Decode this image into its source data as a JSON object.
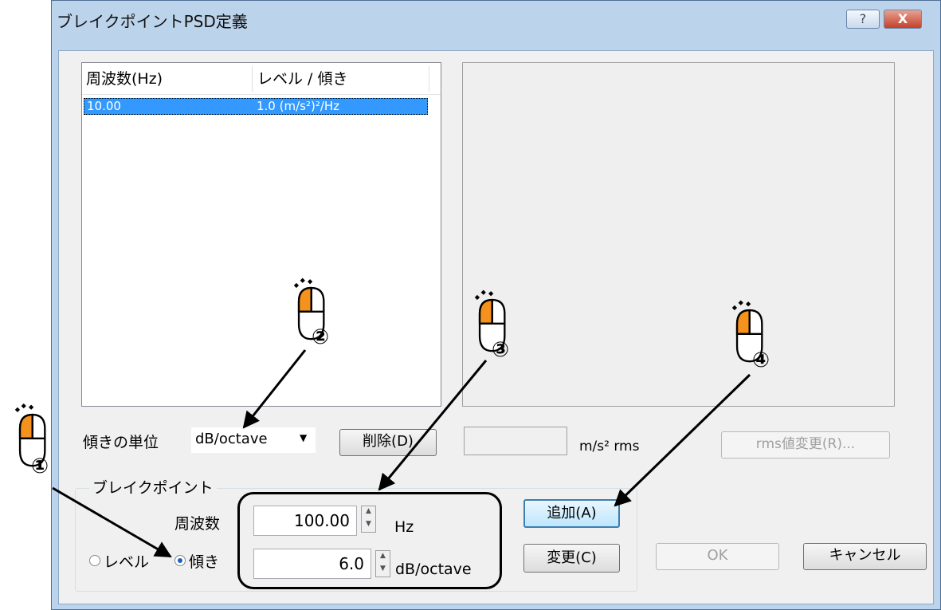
{
  "window": {
    "title": "ブレイクポイントPSD定義",
    "help_glyph": "?",
    "close_glyph": "X"
  },
  "list": {
    "columns": [
      "周波数(Hz)",
      "レベル / 傾き"
    ],
    "rows": [
      {
        "freq": "10.00",
        "value": "1.0 (m/s²)²/Hz",
        "selected": true
      }
    ]
  },
  "slope_unit": {
    "label": "傾きの単位",
    "value": "dB/octave"
  },
  "delete_label": "削除(D)",
  "rms": {
    "value": "",
    "unit": "m/s² rms",
    "change_label": "rms値変更(R)..."
  },
  "breakpoint": {
    "group_label": "ブレイクポイント",
    "freq_label": "周波数",
    "freq_value": "100.00",
    "freq_unit": "Hz",
    "slope_value": "6.0",
    "slope_unit": "dB/octave",
    "radio_level": "レベル",
    "radio_slope": "傾き",
    "selected_mode": "slope"
  },
  "buttons": {
    "add": "追加(A)",
    "change": "変更(C)",
    "ok": "OK",
    "cancel": "キャンセル"
  },
  "annotations": [
    "①",
    "②",
    "③",
    "④"
  ],
  "colors": {
    "selection": "#3399ff",
    "mouse_accent": "#f5921e",
    "titlebar": "#bcd3ec"
  }
}
